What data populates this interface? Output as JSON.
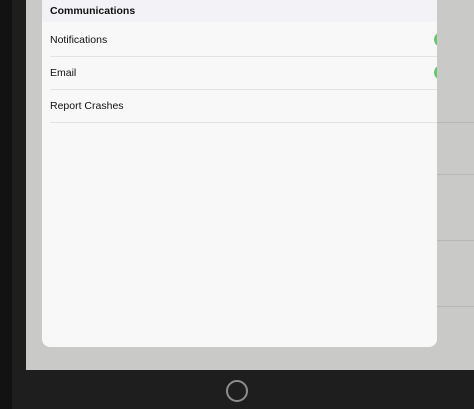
{
  "section": {
    "title": "Communications"
  },
  "rows": [
    {
      "label": "Notifications",
      "toggle": true,
      "toggle_on": true
    },
    {
      "label": "Email",
      "toggle": true,
      "toggle_on": true
    },
    {
      "label": "Report Crashes",
      "toggle": false
    }
  ],
  "colors": {
    "toggle_on": "#66c770",
    "screen_overlay": "#c9cac7",
    "modal_background": "#f8f8f8",
    "device_frame": "#1e1e1e"
  },
  "icons": {
    "home_button": "home-button-icon"
  }
}
